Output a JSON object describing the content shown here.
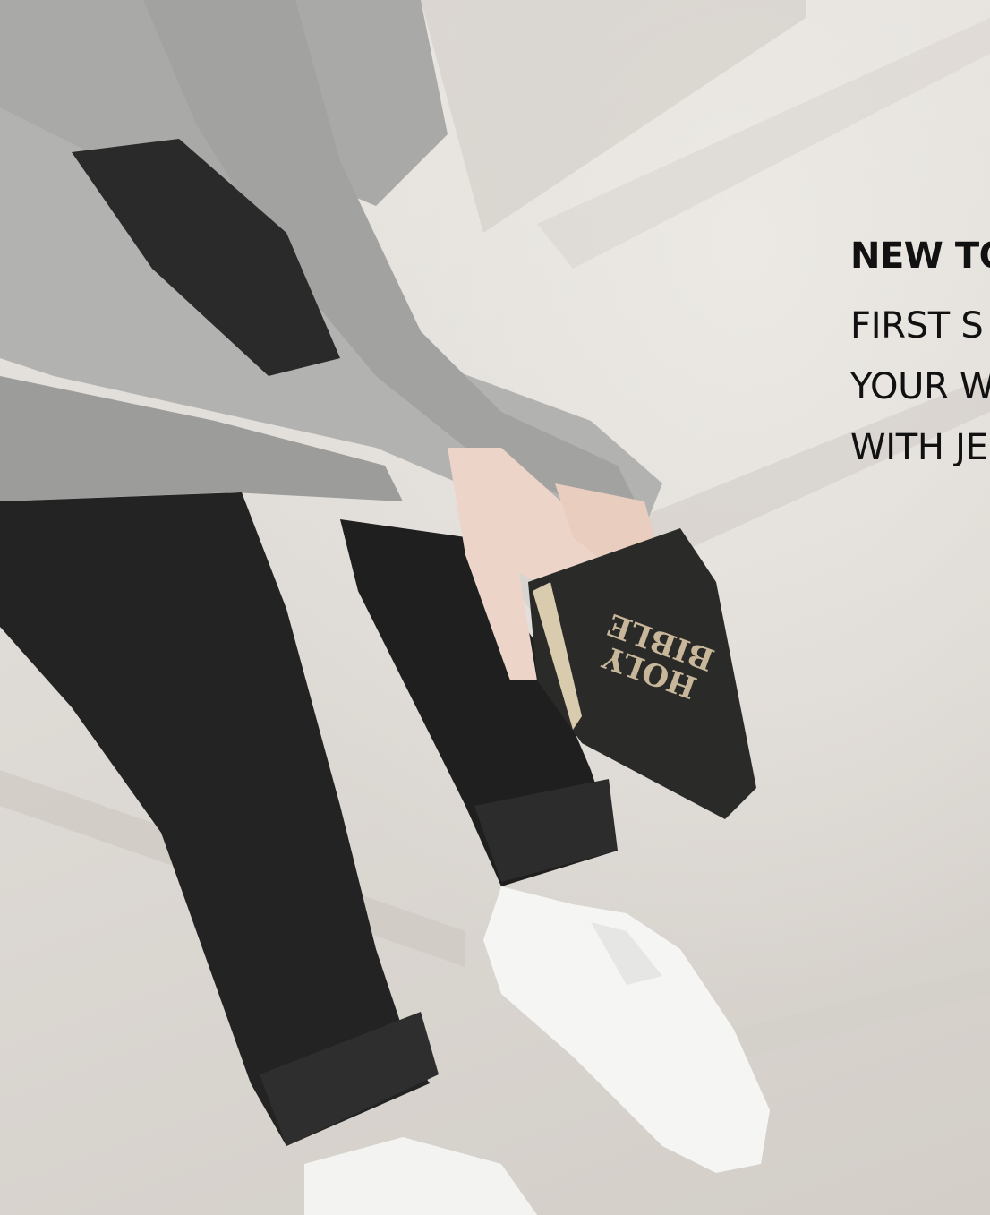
{
  "hero": {
    "heading": "NEW TO",
    "tagline_lines": [
      "FIRST S",
      "YOUR W",
      "WITH JE"
    ],
    "book_title_lines": [
      "HOLY",
      "BIBLE"
    ]
  },
  "colors": {
    "background": "#e2ded9",
    "text": "#111111",
    "sweater": "#a9a9a8",
    "jeans": "#222222",
    "book": "#2a2a28",
    "book_lettering": "#c8b79a",
    "shoes": "#f5f5f3",
    "skin": "#edd4c8"
  }
}
